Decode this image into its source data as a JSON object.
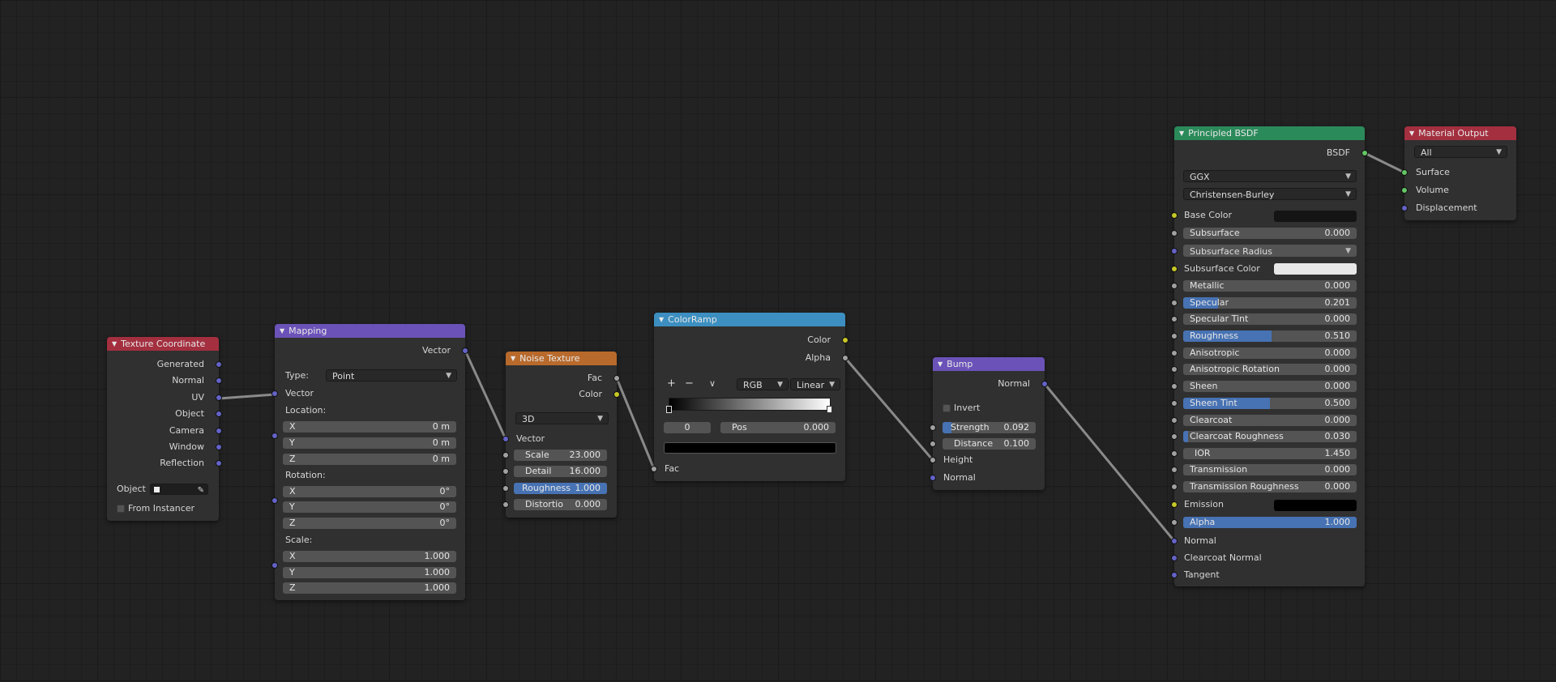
{
  "colors": {
    "header_input": "#a32f3f",
    "header_vector": "#6b52b8",
    "header_texture": "#b86a2c",
    "header_converter": "#3c8fc0",
    "header_shader": "#2b8a5a",
    "header_output": "#a32f3f",
    "field_highlight": "#4772b3"
  },
  "texcoord": {
    "title": "Texture Coordinate",
    "outputs": [
      "Generated",
      "Normal",
      "UV",
      "Object",
      "Camera",
      "Window",
      "Reflection"
    ],
    "object_label": "Object",
    "from_instancer": "From Instancer"
  },
  "mapping": {
    "title": "Mapping",
    "out_vector": "Vector",
    "type_label": "Type:",
    "type_value": "Point",
    "in_vector": "Vector",
    "location_label": "Location:",
    "location": [
      {
        "axis": "X",
        "value": "0 m"
      },
      {
        "axis": "Y",
        "value": "0 m"
      },
      {
        "axis": "Z",
        "value": "0 m"
      }
    ],
    "rotation_label": "Rotation:",
    "rotation": [
      {
        "axis": "X",
        "value": "0°"
      },
      {
        "axis": "Y",
        "value": "0°"
      },
      {
        "axis": "Z",
        "value": "0°"
      }
    ],
    "scale_label": "Scale:",
    "scale": [
      {
        "axis": "X",
        "value": "1.000"
      },
      {
        "axis": "Y",
        "value": "1.000"
      },
      {
        "axis": "Z",
        "value": "1.000"
      }
    ]
  },
  "noise": {
    "title": "Noise Texture",
    "out_fac": "Fac",
    "out_color": "Color",
    "dimensions": "3D",
    "in_vector": "Vector",
    "scale": {
      "label": "Scale",
      "value": "23.000"
    },
    "detail": {
      "label": "Detail",
      "value": "16.000"
    },
    "roughness": {
      "label": "Roughness",
      "value": "1.000"
    },
    "distortion": {
      "label": "Distortio",
      "value": "0.000"
    }
  },
  "colorramp": {
    "title": "ColorRamp",
    "out_color": "Color",
    "out_alpha": "Alpha",
    "add": "+",
    "remove": "−",
    "menu": "∨",
    "color_mode": "RGB",
    "interpolation": "Linear",
    "stop_index": "0",
    "pos_label": "Pos",
    "pos_value": "0.000",
    "stop_color": "#000000",
    "in_fac": "Fac"
  },
  "bump": {
    "title": "Bump",
    "out_normal": "Normal",
    "invert": "Invert",
    "strength": {
      "label": "Strength",
      "value": "0.092",
      "fill": 0.092
    },
    "distance": {
      "label": "Distance",
      "value": "0.100"
    },
    "in_height": "Height",
    "in_normal": "Normal"
  },
  "principled": {
    "title": "Principled BSDF",
    "out_bsdf": "BSDF",
    "distribution": "GGX",
    "subsurface_method": "Christensen-Burley",
    "base_color_label": "Base Color",
    "base_color": "#141414",
    "subsurface": {
      "label": "Subsurface",
      "value": "0.000"
    },
    "subsurface_radius": "Subsurface Radius",
    "subsurface_color_label": "Subsurface Color",
    "subsurface_color": "#e8e8e8",
    "metallic": {
      "label": "Metallic",
      "value": "0.000",
      "fill": 0
    },
    "specular": {
      "label": "Specular",
      "value": "0.201",
      "fill": 0.201
    },
    "specular_tint": {
      "label": "Specular Tint",
      "value": "0.000",
      "fill": 0
    },
    "roughness": {
      "label": "Roughness",
      "value": "0.510",
      "fill": 0.51
    },
    "anisotropic": {
      "label": "Anisotropic",
      "value": "0.000",
      "fill": 0
    },
    "anisotropic_rotation": {
      "label": "Anisotropic Rotation",
      "value": "0.000",
      "fill": 0
    },
    "sheen": {
      "label": "Sheen",
      "value": "0.000",
      "fill": 0
    },
    "sheen_tint": {
      "label": "Sheen Tint",
      "value": "0.500",
      "fill": 0.5
    },
    "clearcoat": {
      "label": "Clearcoat",
      "value": "0.000",
      "fill": 0
    },
    "clearcoat_roughness": {
      "label": "Clearcoat Roughness",
      "value": "0.030",
      "fill": 0.03
    },
    "ior": {
      "label": "IOR",
      "value": "1.450"
    },
    "transmission": {
      "label": "Transmission",
      "value": "0.000",
      "fill": 0
    },
    "transmission_roughness": {
      "label": "Transmission Roughness",
      "value": "0.000",
      "fill": 0
    },
    "emission_label": "Emission",
    "emission_color": "#000000",
    "alpha": {
      "label": "Alpha",
      "value": "1.000",
      "fill": 1.0
    },
    "in_normal": "Normal",
    "in_clearcoat_normal": "Clearcoat Normal",
    "in_tangent": "Tangent"
  },
  "output": {
    "title": "Material Output",
    "target": "All",
    "in_surface": "Surface",
    "in_volume": "Volume",
    "in_displacement": "Displacement"
  }
}
